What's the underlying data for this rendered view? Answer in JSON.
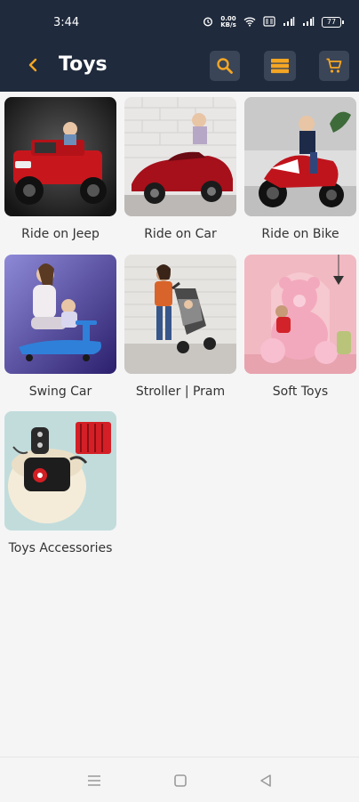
{
  "status_bar": {
    "time": "3:44",
    "network_speed": "0.00\nKB/s",
    "battery": "77"
  },
  "appbar": {
    "title": "Toys",
    "back_icon": "chevron-left-icon",
    "actions": [
      "search-icon",
      "list-view-icon",
      "cart-icon"
    ]
  },
  "categories": [
    {
      "label": "Ride on Jeep"
    },
    {
      "label": "Ride on Car"
    },
    {
      "label": "Ride on Bike"
    },
    {
      "label": "Swing Car"
    },
    {
      "label": "Stroller | Pram"
    },
    {
      "label": "Soft Toys"
    },
    {
      "label": "Toys Accessories"
    }
  ],
  "colors": {
    "header_bg": "#1f2a3c",
    "accent": "#f5a623",
    "action_bg": "#3a4558"
  },
  "navbar": {
    "icons": [
      "menu-icon",
      "home-square-icon",
      "back-triangle-icon"
    ]
  }
}
